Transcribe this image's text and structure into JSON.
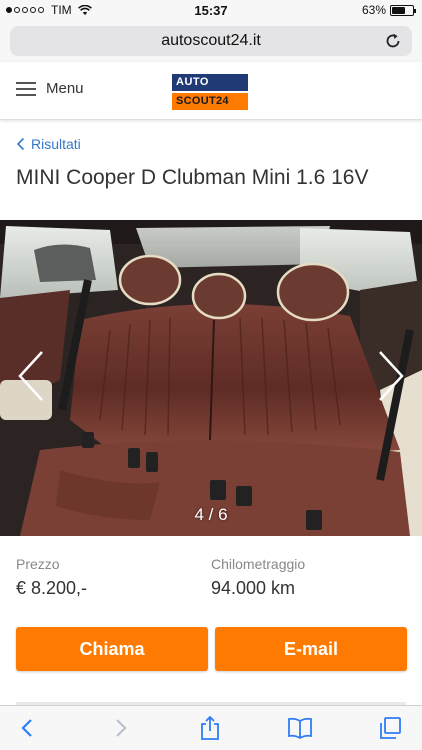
{
  "status_bar": {
    "carrier": "TIM",
    "time": "15:37",
    "battery": "63%",
    "battery_level": 0.63
  },
  "browser": {
    "url": "autoscout24.it"
  },
  "header": {
    "menu_label": "Menu",
    "logo_top": "AUTO",
    "logo_bottom": "SCOUT24"
  },
  "breadcrumb": "Risultati",
  "title": "MINI Cooper D Clubman Mini 1.6 16V",
  "gallery": {
    "counter": "4 / 6"
  },
  "specs": [
    {
      "label": "Prezzo",
      "value": "€ 8.200,-"
    },
    {
      "label": "Chilometraggio",
      "value": "94.000 km"
    }
  ],
  "buttons": {
    "call": "Chiama",
    "email": "E-mail"
  },
  "colors": {
    "accent": "#ff7a00",
    "link": "#3478c6",
    "logo_blue": "#1f3a74"
  }
}
